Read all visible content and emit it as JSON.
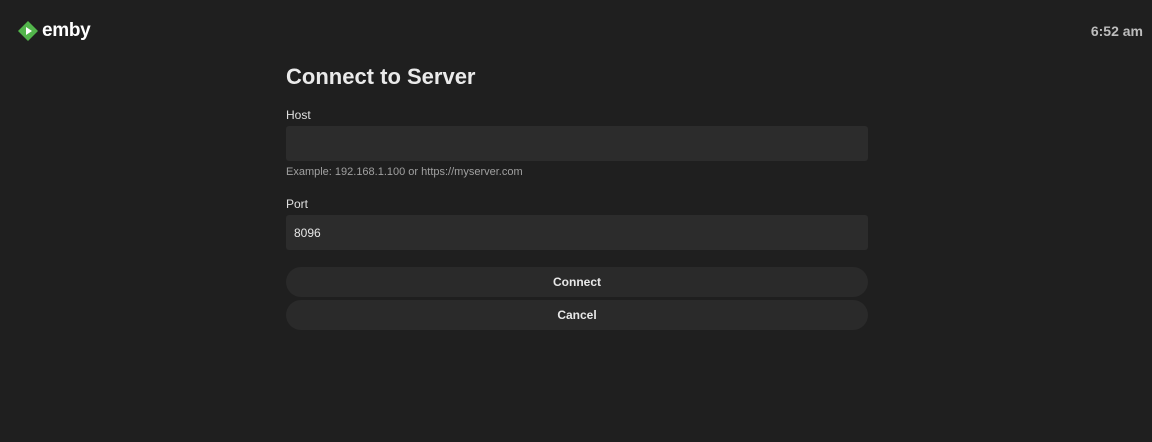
{
  "app": {
    "logo_text": "emby",
    "logo_icon": "emby-logo-icon",
    "brand_color": "#52b54b",
    "clock": "6:52 am"
  },
  "form": {
    "title": "Connect to Server",
    "host": {
      "label": "Host",
      "value": "",
      "hint": "Example: 192.168.1.100 or https://myserver.com"
    },
    "port": {
      "label": "Port",
      "value": "8096"
    },
    "connect_label": "Connect",
    "cancel_label": "Cancel"
  }
}
